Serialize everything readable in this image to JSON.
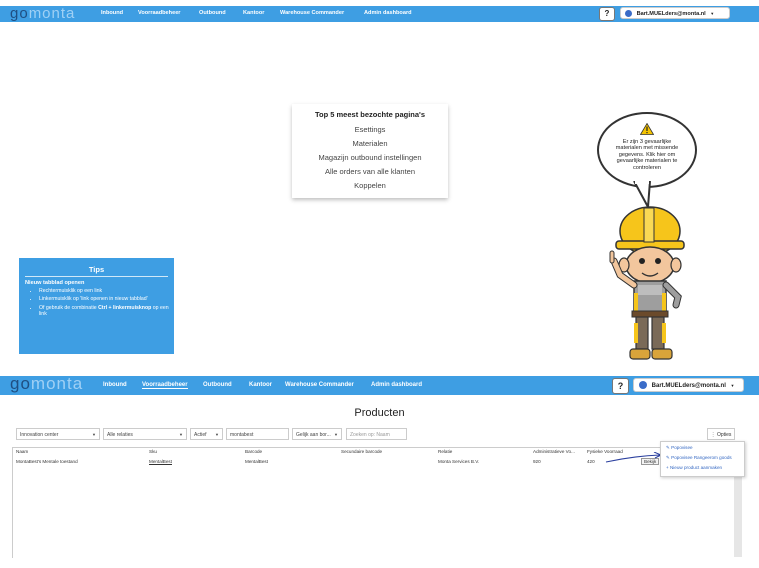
{
  "nav": {
    "logo_go": "go",
    "logo_monta": "monta",
    "links": [
      "Inbound",
      "Voorraadbeheer",
      "Outbound",
      "Kantoor",
      "Warehouse Commander",
      "Admin dashboard"
    ],
    "help": "?",
    "user": "Bart.MUELders@monta.nl"
  },
  "top5": {
    "title": "Top 5 meest bezochte pagina's",
    "items": [
      "Esettings",
      "Materialen",
      "Magazijn outbound instellingen",
      "Alle orders van alle klanten",
      "Koppelen"
    ]
  },
  "bubble": {
    "icon": "warning-icon",
    "text": "Er zijn 3 gevaarlijke materialen met missende gegevens. Klik hier om gevaarlijke materialen te controleren"
  },
  "tips": {
    "title": "Tips",
    "subtitle": "Nieuw tabblad openen",
    "items": [
      {
        "text": "Rechtermuisklik op een link",
        "bold": ""
      },
      {
        "text": "Linkermuisklik op 'link openen in nieuw tabblad'",
        "bold": ""
      },
      {
        "text": "Of gebruik de combinatie ",
        "bold": "Ctrl + linkermuisknop",
        "after": " op een link"
      }
    ]
  },
  "producten": {
    "title": "Producten",
    "filters": {
      "client": "Innovation center",
      "relation": "Alle relaties",
      "status": "Actief",
      "search_value": "montabest",
      "match": "Gelijk aan bor...",
      "search_placeholder": "Zoeken op: Naam"
    },
    "options": "⋮ Opties",
    "columns": [
      "Naam",
      "Sku",
      "Barcode",
      "Secundaire barcode",
      "Relatie",
      "Administratieve Vo...",
      "Fysieke Voorraad"
    ],
    "row": {
      "naam": "MontaBest's Mentale toestand",
      "sku": "MentalBest",
      "barcode": "MentalBest",
      "secundaire": "",
      "relatie": "Monta Services B.V.",
      "admin": "920",
      "fysiek": "420",
      "bekijk": "Bekijk"
    },
    "context_menu": [
      "Popovisee",
      "Popovisee Rangeerom goods",
      "+ Nieuw product aanmaken"
    ]
  },
  "colors": {
    "nav_bar": "#3e9ee3",
    "tips_bg": "#3e9ee3",
    "logo_go": "#1f4f82",
    "logo_monta": "#9fd0f5"
  }
}
